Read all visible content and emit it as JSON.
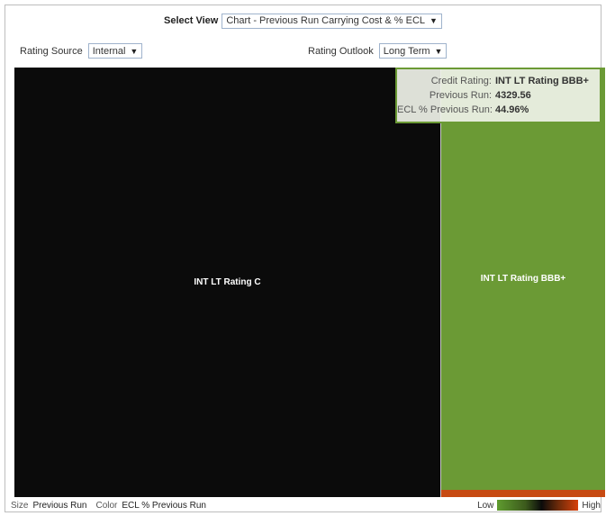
{
  "controls": {
    "select_view_label": "Select View",
    "select_view_value": "Chart - Previous Run Carrying Cost & % ECL",
    "rating_source_label": "Rating Source",
    "rating_source_value": "Internal",
    "rating_outlook_label": "Rating Outlook",
    "rating_outlook_value": "Long Term",
    "dropdown_icon": "▼"
  },
  "treemap": {
    "tiles": [
      {
        "label": "INT LT Rating C",
        "color": "#0b0b0b"
      },
      {
        "label": "INT LT Rating BBB+",
        "color": "#6b9a35"
      },
      {
        "label": "",
        "color": "#c74a12"
      }
    ]
  },
  "tooltip": {
    "rows": [
      {
        "key": "Credit Rating:",
        "value": "INT LT Rating BBB+"
      },
      {
        "key": "Previous Run:",
        "value": "4329.56"
      },
      {
        "key": "ECL % Previous Run:",
        "value": "44.96%"
      }
    ],
    "border_color": "#6b9a35"
  },
  "footer": {
    "size_label": "Size",
    "size_value": "Previous Run",
    "color_label": "Color",
    "color_value": "ECL % Previous Run",
    "legend_low": "Low",
    "legend_high": "High"
  }
}
